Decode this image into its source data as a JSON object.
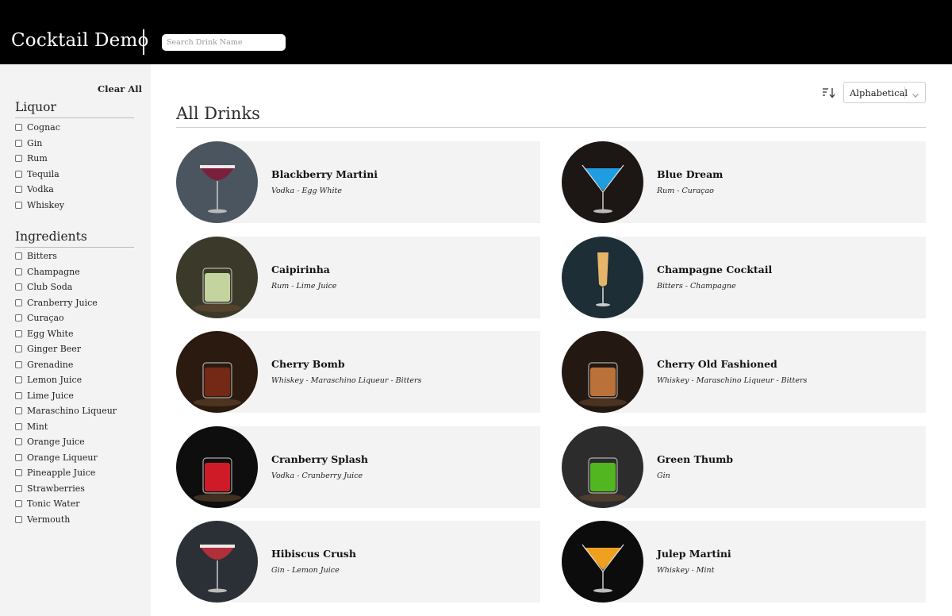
{
  "header": {
    "title": "Cocktail Demo",
    "search_placeholder": "Search Drink Name",
    "search_value": ""
  },
  "sidebar": {
    "clear_all_label": "Clear All",
    "liquor": {
      "title": "Liquor",
      "items": [
        "Cognac",
        "Gin",
        "Rum",
        "Tequila",
        "Vodka",
        "Whiskey"
      ]
    },
    "ingredients": {
      "title": "Ingredients",
      "items": [
        "Bitters",
        "Champagne",
        "Club Soda",
        "Cranberry Juice",
        "Curaçao",
        "Egg White",
        "Ginger Beer",
        "Grenadine",
        "Lemon Juice",
        "Lime Juice",
        "Maraschino Liqueur",
        "Mint",
        "Orange Juice",
        "Orange Liqueur",
        "Pineapple Juice",
        "Strawberries",
        "Tonic Water",
        "Vermouth"
      ]
    }
  },
  "main": {
    "title": "All Drinks",
    "sort": {
      "icon": "sort-descending-icon",
      "selected": "Alphabetical",
      "chevron": "chevron-down-icon"
    },
    "drinks": [
      {
        "name": "Blackberry Martini",
        "ingredients": "Vodka - Egg White",
        "image": "coupe-glass-photo",
        "liquid": "#7a1f3c",
        "bg": "#4a5560"
      },
      {
        "name": "Blue Dream",
        "ingredients": "Rum - Curaçao",
        "image": "martini-glass-photo",
        "liquid": "#1e9ee0",
        "bg": "#1c1714"
      },
      {
        "name": "Caipirinha",
        "ingredients": "Rum - Lime Juice",
        "image": "rocks-glass-photo",
        "liquid": "#cfe2a8",
        "bg": "#3b3a2a"
      },
      {
        "name": "Champagne Cocktail",
        "ingredients": "Bitters - Champagne",
        "image": "flute-glass-photo",
        "liquid": "#e7b56a",
        "bg": "#1d2e36"
      },
      {
        "name": "Cherry Bomb",
        "ingredients": "Whiskey - Maraschino Liqueur - Bitters",
        "image": "rocks-glass-photo",
        "liquid": "#7a2a16",
        "bg": "#2a1a10"
      },
      {
        "name": "Cherry Old Fashioned",
        "ingredients": "Whiskey - Maraschino Liqueur - Bitters",
        "image": "rocks-glass-photo",
        "liquid": "#c97a3e",
        "bg": "#241812"
      },
      {
        "name": "Cranberry Splash",
        "ingredients": "Vodka - Cranberry Juice",
        "image": "rocks-glass-photo",
        "liquid": "#e01b2a",
        "bg": "#0e0e0e"
      },
      {
        "name": "Green Thumb",
        "ingredients": "Gin",
        "image": "rocks-glass-photo",
        "liquid": "#55c21f",
        "bg": "#2c2c2c"
      },
      {
        "name": "Hibiscus Crush",
        "ingredients": "Gin - Lemon Juice",
        "image": "coupe-glass-photo",
        "liquid": "#b0303a",
        "bg": "#2a3036"
      },
      {
        "name": "Julep Martini",
        "ingredients": "Whiskey - Mint",
        "image": "martini-glass-photo",
        "liquid": "#f0a020",
        "bg": "#0c0c0c"
      }
    ]
  }
}
